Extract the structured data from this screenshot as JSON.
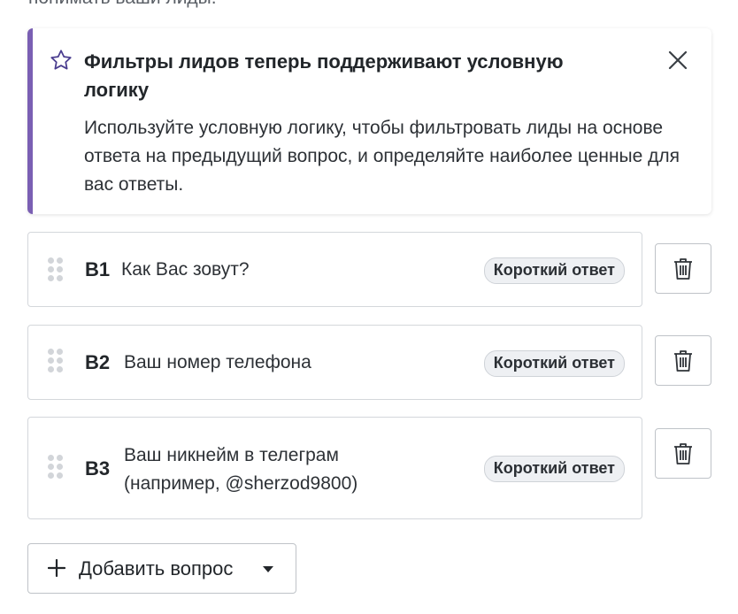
{
  "header": {
    "cut_text": "понимать ваши лиды."
  },
  "banner": {
    "title": "Фильтры лидов теперь поддерживают условную логику",
    "body": "Используйте условную логику, чтобы фильтровать лиды на основе ответа на предыдущий вопрос, и определяйте наиболее ценные для вас ответы.",
    "accent_color": "#7a5fb3",
    "icon": "star-icon",
    "close_icon": "close-icon"
  },
  "questions": [
    {
      "num": "В1",
      "text": "Как Вас зовут?",
      "type": "Короткий ответ"
    },
    {
      "num": "В2",
      "text": "Ваш номер телефона",
      "type": "Короткий ответ"
    },
    {
      "num": "В3",
      "text": "Ваш никнейм в телеграм (например, @sherzod9800)",
      "type": "Короткий ответ"
    }
  ],
  "add_button": {
    "label": "Добавить вопрос",
    "icon": "plus-icon",
    "caret_icon": "caret-down-icon"
  },
  "delete_icon": "trash-icon"
}
